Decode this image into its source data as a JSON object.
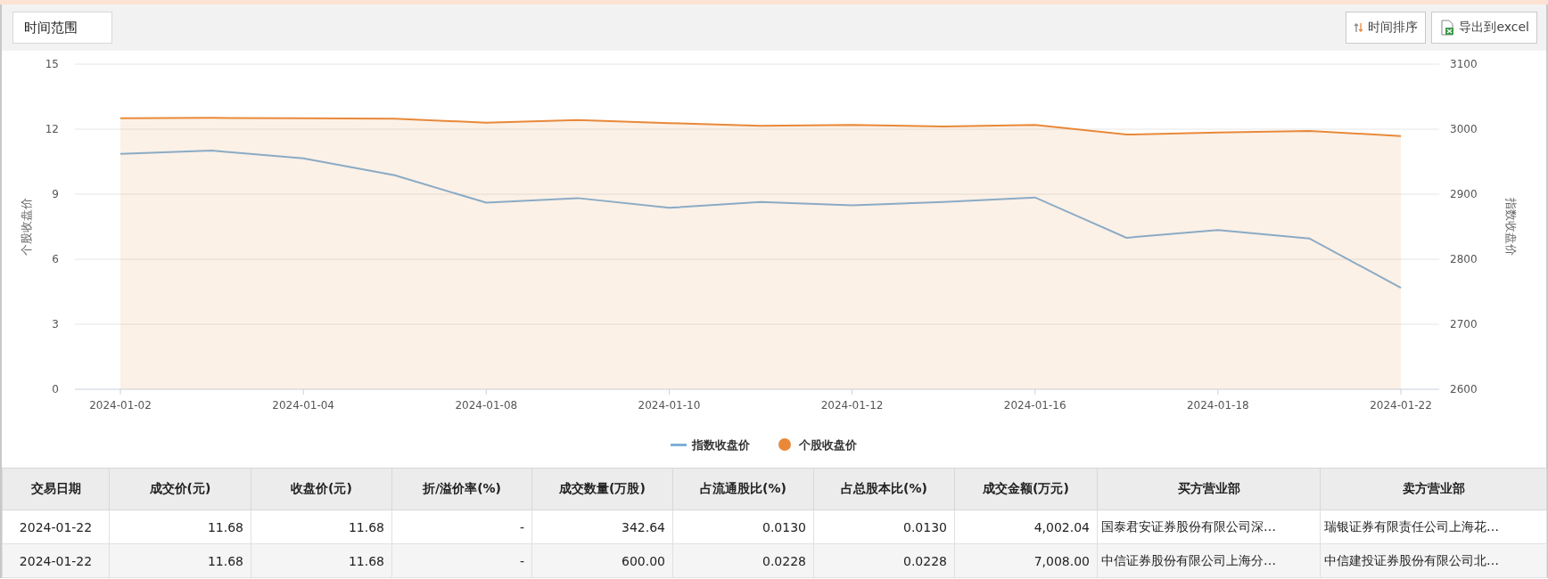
{
  "toolbar": {
    "range_button": "时间范围",
    "sort_button": "时间排序",
    "export_button": "导出到excel"
  },
  "chart": {
    "chart_data": {
      "type": "line",
      "grid": true,
      "legend": "bottom",
      "ylabel": "个股收盘价",
      "y2label": "指数收盘价",
      "categories": [
        "2024-01-02",
        null,
        "2024-01-04",
        null,
        "2024-01-08",
        null,
        "2024-01-10",
        null,
        "2024-01-12",
        null,
        "2024-01-16",
        null,
        "2024-01-18",
        null,
        "2024-01-22"
      ],
      "ylim": [
        0,
        15
      ],
      "yticks": [
        0,
        3,
        6,
        9,
        12,
        15
      ],
      "y2lim": [
        2600,
        3100
      ],
      "y2ticks": [
        2600,
        2700,
        2800,
        2900,
        3000,
        3100
      ],
      "series": [
        {
          "name": "指数收盘价",
          "color": "#7eb0d9",
          "type": "line",
          "axis": "y2",
          "values": [
            2962,
            2967,
            2955,
            2929,
            2887,
            2894,
            2879,
            2888,
            2883,
            2888,
            2895,
            2833,
            2845,
            2832,
            2756
          ]
        },
        {
          "name": "个股收盘价",
          "color": "#e8893a",
          "type": "area",
          "values": [
            12.5,
            12.52,
            12.5,
            12.48,
            12.3,
            12.42,
            12.28,
            12.15,
            12.2,
            12.12,
            12.2,
            11.75,
            11.85,
            11.92,
            11.68
          ]
        }
      ]
    }
  },
  "table": {
    "columns": [
      "交易日期",
      "成交价(元)",
      "收盘价(元)",
      "折/溢价率(%)",
      "成交数量(万股)",
      "占流通股比(%)",
      "占总股本比(%)",
      "成交金额(万元)",
      "买方营业部",
      "卖方营业部"
    ],
    "rows": [
      [
        "2024-01-22",
        "11.68",
        "11.68",
        "-",
        "342.64",
        "0.0130",
        "0.0130",
        "4,002.04",
        "国泰君安证券股份有限公司深…",
        "瑞银证券有限责任公司上海花…"
      ],
      [
        "2024-01-22",
        "11.68",
        "11.68",
        "-",
        "600.00",
        "0.0228",
        "0.0228",
        "7,008.00",
        "中信证券股份有限公司上海分…",
        "中信建投证券股份有限公司北…"
      ]
    ]
  }
}
